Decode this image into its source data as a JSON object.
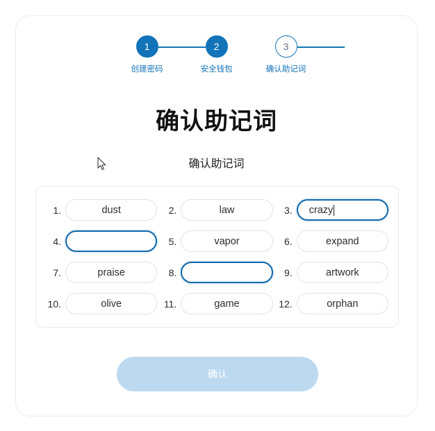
{
  "stepper": {
    "steps": [
      {
        "number": "1",
        "label": "创建密码",
        "state": "done"
      },
      {
        "number": "2",
        "label": "安全钱包",
        "state": "done"
      },
      {
        "number": "3",
        "label": "确认助记词",
        "state": "todo"
      }
    ]
  },
  "heading": {
    "title": "确认助记词",
    "subtitle": "确认助记词"
  },
  "word_grid": {
    "cells": [
      {
        "index": "1.",
        "value": "dust",
        "focused": false
      },
      {
        "index": "2.",
        "value": "law",
        "focused": false
      },
      {
        "index": "3.",
        "value": "crazy",
        "focused": true
      },
      {
        "index": "4.",
        "value": "",
        "focused": true
      },
      {
        "index": "5.",
        "value": "vapor",
        "focused": false
      },
      {
        "index": "6.",
        "value": "expand",
        "focused": false
      },
      {
        "index": "7.",
        "value": "praise",
        "focused": false
      },
      {
        "index": "8.",
        "value": "",
        "focused": true
      },
      {
        "index": "9.",
        "value": "artwork",
        "focused": false
      },
      {
        "index": "10.",
        "value": "olive",
        "focused": false
      },
      {
        "index": "11.",
        "value": "game",
        "focused": false
      },
      {
        "index": "12.",
        "value": "orphan",
        "focused": false
      }
    ]
  },
  "confirm": {
    "label": "确认"
  },
  "colors": {
    "accent": "#1273b8",
    "focus_border": "#1268a8",
    "button_disabled": "#bcd9f0",
    "panel_border": "#eaeaea",
    "card_border": "#ececec"
  }
}
